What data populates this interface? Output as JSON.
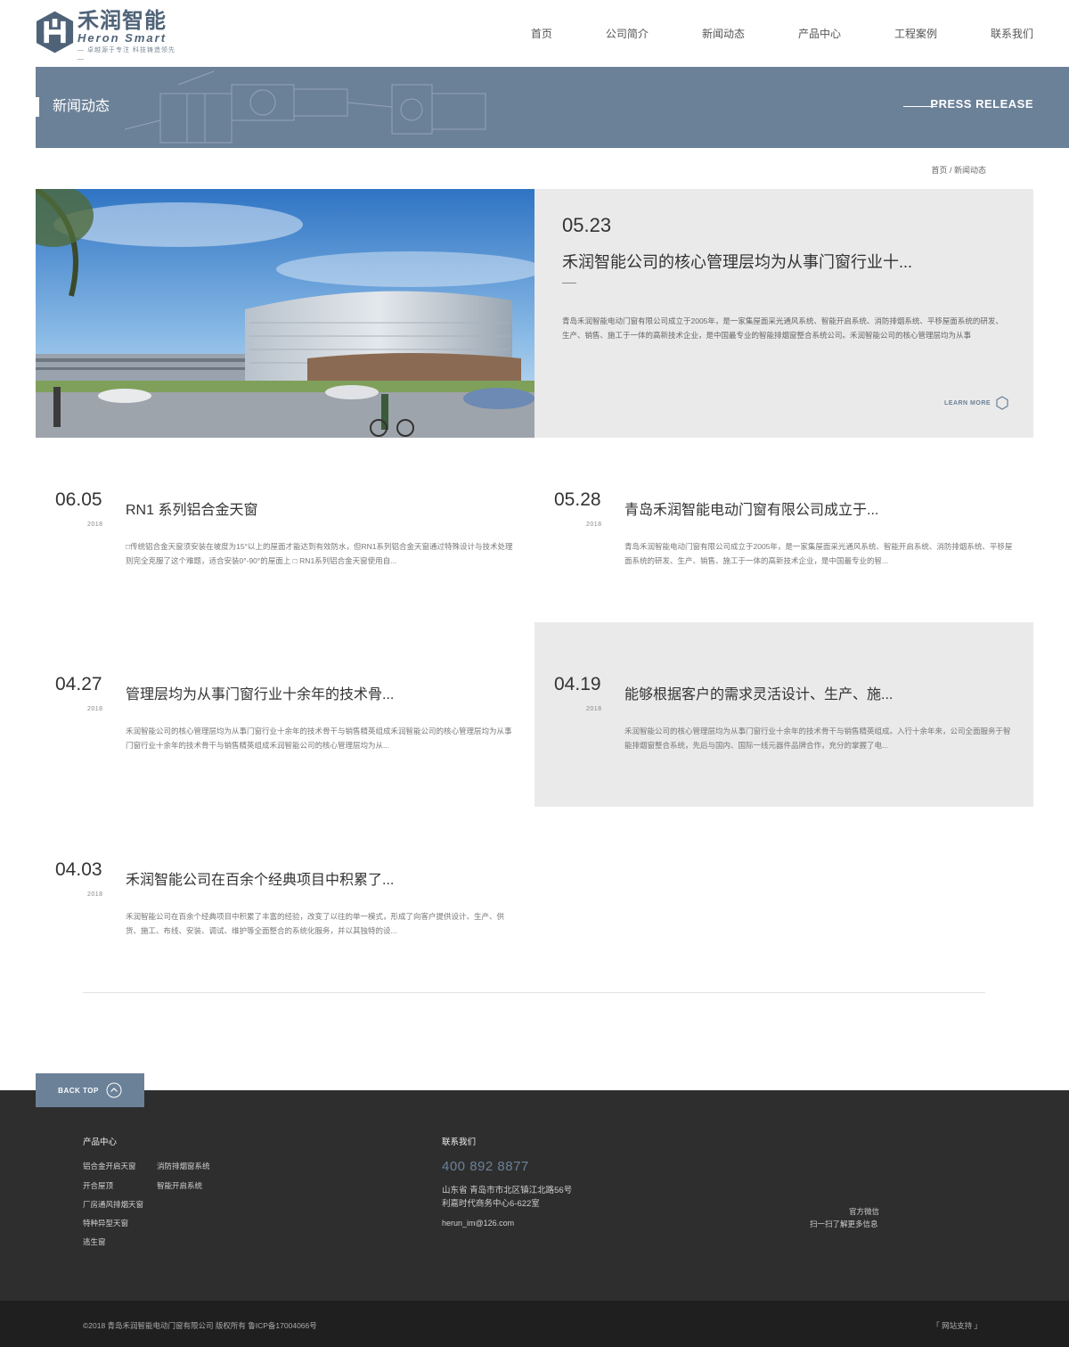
{
  "header": {
    "logo_cn": "禾润智能",
    "logo_en": "Heron Smart",
    "logo_slogan": "— 卓越源于专注 科技铸造领先 —",
    "nav": [
      "首页",
      "公司简介",
      "新闻动态",
      "产品中心",
      "工程案例",
      "联系我们"
    ]
  },
  "banner": {
    "title": "新闻动态",
    "subtitle_en": "PRESS RELEASE"
  },
  "breadcrumb": {
    "home": "首页",
    "separator": "/",
    "current": "新闻动态"
  },
  "featured": {
    "date": "05.23",
    "title": "禾润智能公司的核心管理层均为从事门窗行业十...",
    "description": "青岛禾润智能电动门窗有限公司成立于2005年，是一家集屋面采光通风系统、智能开启系统、消防排烟系统、平移屋面系统的研发、生产、销售、施工于一体的高新技术企业，是中国最专业的智能排烟窗整合系统公司。禾润智能公司的核心管理层均为从事",
    "learn_more": "LEARN MORE"
  },
  "news": [
    {
      "date": "06.05",
      "year": "2018",
      "title": "RN1 系列铝合金天窗",
      "description": "□传统铝合金天窗须安装在坡度为15°以上的屋面才能达到有效防水，但RN1系列铝合金天窗通过特殊设计与技术处理则完全克服了这个难题，适合安装0°-90°的屋面上 □ RN1系列铝合金天窗使用自..."
    },
    {
      "date": "05.28",
      "year": "2018",
      "title": "青岛禾润智能电动门窗有限公司成立于...",
      "description": "青岛禾润智能电动门窗有限公司成立于2005年，是一家集屋面采光通风系统、智能开启系统、消防排烟系统、平移屋面系统的研发、生产、销售、施工于一体的高新技术企业，是中国最专业的智..."
    },
    {
      "date": "04.27",
      "year": "2018",
      "title": "管理层均为从事门窗行业十余年的技术骨...",
      "description": "禾润智能公司的核心管理层均为从事门窗行业十余年的技术骨干与销售精英组成禾润智能公司的核心管理层均为从事门窗行业十余年的技术骨干与销售精英组成禾润智能公司的核心管理层均为从..."
    },
    {
      "date": "04.19",
      "year": "2018",
      "title": "能够根据客户的需求灵活设计、生产、施...",
      "description": "禾润智能公司的核心管理层均为从事门窗行业十余年的技术骨干与销售精英组成。入行十余年来，公司全面服务于智能排烟窗整合系统，先后与国内、国际一线元器件品牌合作，充分的掌握了电..."
    },
    {
      "date": "04.03",
      "year": "2018",
      "title": "禾润智能公司在百余个经典项目中积累了...",
      "description": "禾润智能公司在百余个经典项目中积累了丰富的经验，改变了以往的单一模式，形成了向客户提供设计、生产、供货、施工、布线、安装、调试、维护等全面整合的系统化服务，并以其独特的设..."
    }
  ],
  "footer": {
    "back_top": "BACK TOP",
    "products_heading": "产品中心",
    "products": [
      "铝合金开启天窗",
      "消防排烟窗系统",
      "开合屋顶",
      "智能开启系统",
      "厂房通风排烟天窗",
      "特种异型天窗",
      "逃生窗"
    ],
    "contact_heading": "联系我们",
    "phone": "400 892 8877",
    "address_line1": "山东省 青岛市市北区镇江北路56号",
    "address_line2": "利嘉时代商务中心6-622室",
    "email": "herun_im@126.com",
    "wechat_label": "官方微信",
    "wechat_hint": "扫一扫了解更多信息",
    "copyright": "©2018 青岛禾润智能电动门窗有限公司 版权所有 鲁ICP备17004066号",
    "support": "「 网站支持 」"
  }
}
